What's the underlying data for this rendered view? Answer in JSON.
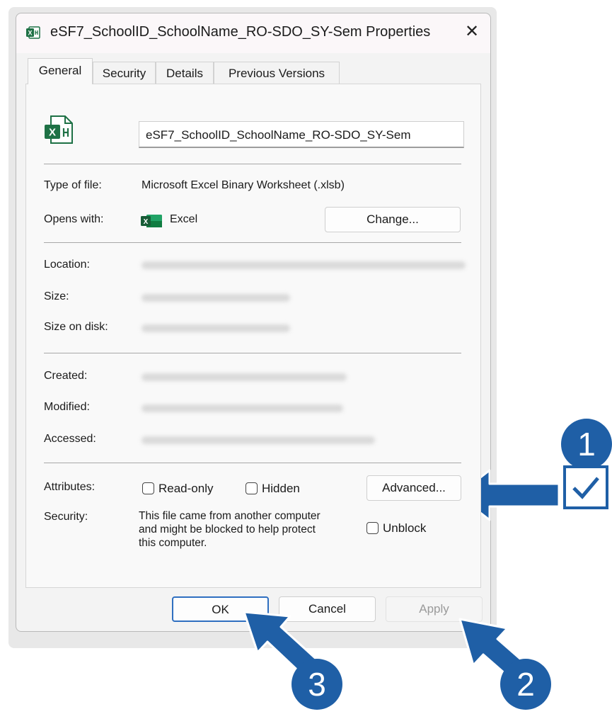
{
  "window": {
    "title": "eSF7_SchoolID_SchoolName_RO-SDO_SY-Sem Properties",
    "close_glyph": "✕",
    "icons": [
      "excel-icon",
      "close-icon"
    ]
  },
  "tabs": [
    {
      "label": "General",
      "active": true
    },
    {
      "label": "Security",
      "active": false
    },
    {
      "label": "Details",
      "active": false
    },
    {
      "label": "Previous Versions",
      "active": false
    }
  ],
  "general": {
    "filename": "eSF7_SchoolID_SchoolName_RO-SDO_SY-Sem",
    "type_label": "Type of file:",
    "type_value": "Microsoft Excel Binary Worksheet (.xlsb)",
    "opens_label": "Opens with:",
    "opens_value": "Excel",
    "change_button": "Change...",
    "location_label": "Location:",
    "size_label": "Size:",
    "size_on_disk_label": "Size on disk:",
    "created_label": "Created:",
    "modified_label": "Modified:",
    "accessed_label": "Accessed:",
    "attributes_label": "Attributes:",
    "readonly_label": "Read-only",
    "hidden_label": "Hidden",
    "advanced_button": "Advanced...",
    "security_label": "Security:",
    "security_text": [
      "This file came from another computer",
      "and might be blocked to help protect",
      "this computer."
    ],
    "unblock_label": "Unblock"
  },
  "footer": {
    "ok": "OK",
    "cancel": "Cancel",
    "apply": "Apply"
  },
  "annotations": {
    "step1": "1",
    "step2": "2",
    "step3": "3",
    "color": "#1f5fa6"
  },
  "colors": {
    "excel_green": "#1e7145",
    "ok_border": "#2f6fc0",
    "apply_text": "#9a9a9a"
  }
}
